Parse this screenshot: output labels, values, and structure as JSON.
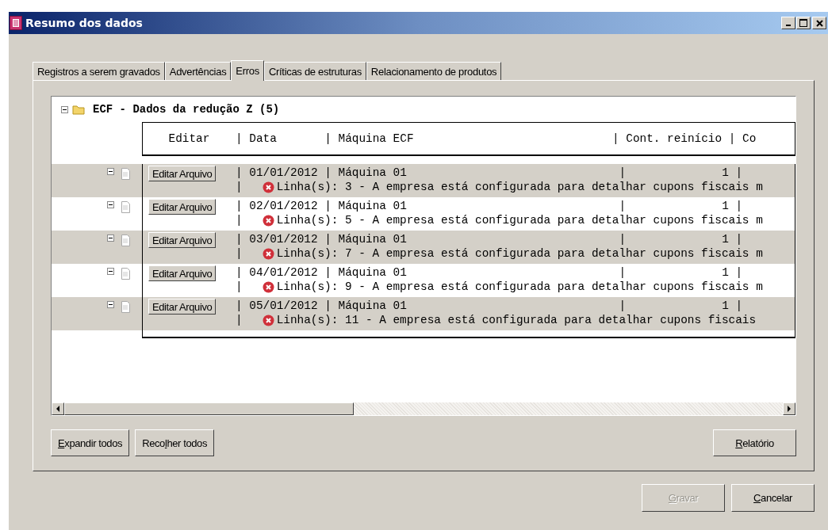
{
  "window": {
    "title": "Resumo dos dados"
  },
  "tabs": [
    {
      "label": "Registros a serem gravados",
      "selected": false
    },
    {
      "label": "Advertências",
      "selected": false
    },
    {
      "label": "Erros",
      "selected": true
    },
    {
      "label": "Críticas de estruturas",
      "selected": false
    },
    {
      "label": "Relacionamento de produtos",
      "selected": false
    }
  ],
  "tree": {
    "group": {
      "label": "ECF - Dados da redução Z (5)",
      "expanded": true
    },
    "header": {
      "edit_column": "Editar",
      "line": "| Data       | Máquina ECF                             | Cont. reinício | Co"
    },
    "rows": [
      {
        "expanded": true,
        "button": "Editar Arquivo",
        "line": "| 01/01/2012 | Máquina 01                               |              1 |",
        "error_separator": "|",
        "error": "Linha(s): 3 - A empresa está configurada para detalhar cupons fiscais m"
      },
      {
        "expanded": true,
        "button": "Editar Arquivo",
        "line": "| 02/01/2012 | Máquina 01                               |              1 |",
        "error_separator": "|",
        "error": "Linha(s): 5 - A empresa está configurada para detalhar cupons fiscais m"
      },
      {
        "expanded": true,
        "button": "Editar Arquivo",
        "line": "| 03/01/2012 | Máquina 01                               |              1 |",
        "error_separator": "|",
        "error": "Linha(s): 7 - A empresa está configurada para detalhar cupons fiscais m"
      },
      {
        "expanded": true,
        "button": "Editar Arquivo",
        "line": "| 04/01/2012 | Máquina 01                               |              1 |",
        "error_separator": "|",
        "error": "Linha(s): 9 - A empresa está configurada para detalhar cupons fiscais m"
      },
      {
        "expanded": true,
        "button": "Editar Arquivo",
        "line": "| 05/01/2012 | Máquina 01                               |              1 |",
        "error_separator": "|",
        "error": "Linha(s): 11 - A empresa está configurada para detalhar cupons fiscais"
      }
    ]
  },
  "panel_buttons": [
    {
      "key": "E",
      "after": "xpandir todos"
    },
    {
      "before": "Reco",
      "key": "l",
      "after": "her todos"
    }
  ],
  "report_button": {
    "key": "R",
    "after": "elatório"
  },
  "footer_buttons": [
    {
      "key": "G",
      "after": "ravar",
      "disabled": true
    },
    {
      "key": "C",
      "after": "ancelar",
      "disabled": false
    }
  ]
}
